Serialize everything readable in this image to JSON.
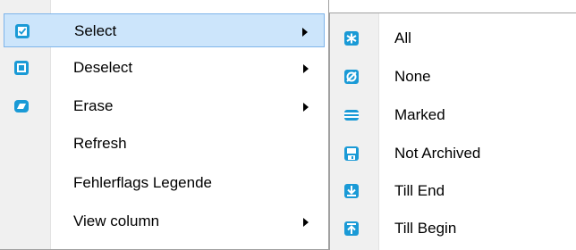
{
  "main_menu": {
    "items": [
      {
        "label": "Select",
        "icon": "select-checkbox-icon",
        "has_submenu": true,
        "highlighted": true
      },
      {
        "label": "Deselect",
        "icon": "deselect-square-icon",
        "has_submenu": true
      },
      {
        "label": "Erase",
        "icon": "eraser-icon",
        "has_submenu": true
      },
      {
        "label": "Refresh",
        "icon": "",
        "has_submenu": false
      },
      {
        "label": "Fehlerflags Legende",
        "icon": "",
        "has_submenu": false
      },
      {
        "label": "View column",
        "icon": "",
        "has_submenu": true
      }
    ]
  },
  "sub_menu": {
    "items": [
      {
        "label": "All",
        "icon": "asterisk-icon"
      },
      {
        "label": "None",
        "icon": "empty-set-icon"
      },
      {
        "label": "Marked",
        "icon": "marked-lines-icon"
      },
      {
        "label": "Not Archived",
        "icon": "floppy-disk-icon"
      },
      {
        "label": "Till End",
        "icon": "arrow-to-end-icon"
      },
      {
        "label": "Till Begin",
        "icon": "arrow-to-begin-icon"
      }
    ]
  },
  "colors": {
    "icon_accent": "#1a9ad6",
    "highlight": "#cce5fb",
    "highlight_border": "#7eb4ea"
  }
}
